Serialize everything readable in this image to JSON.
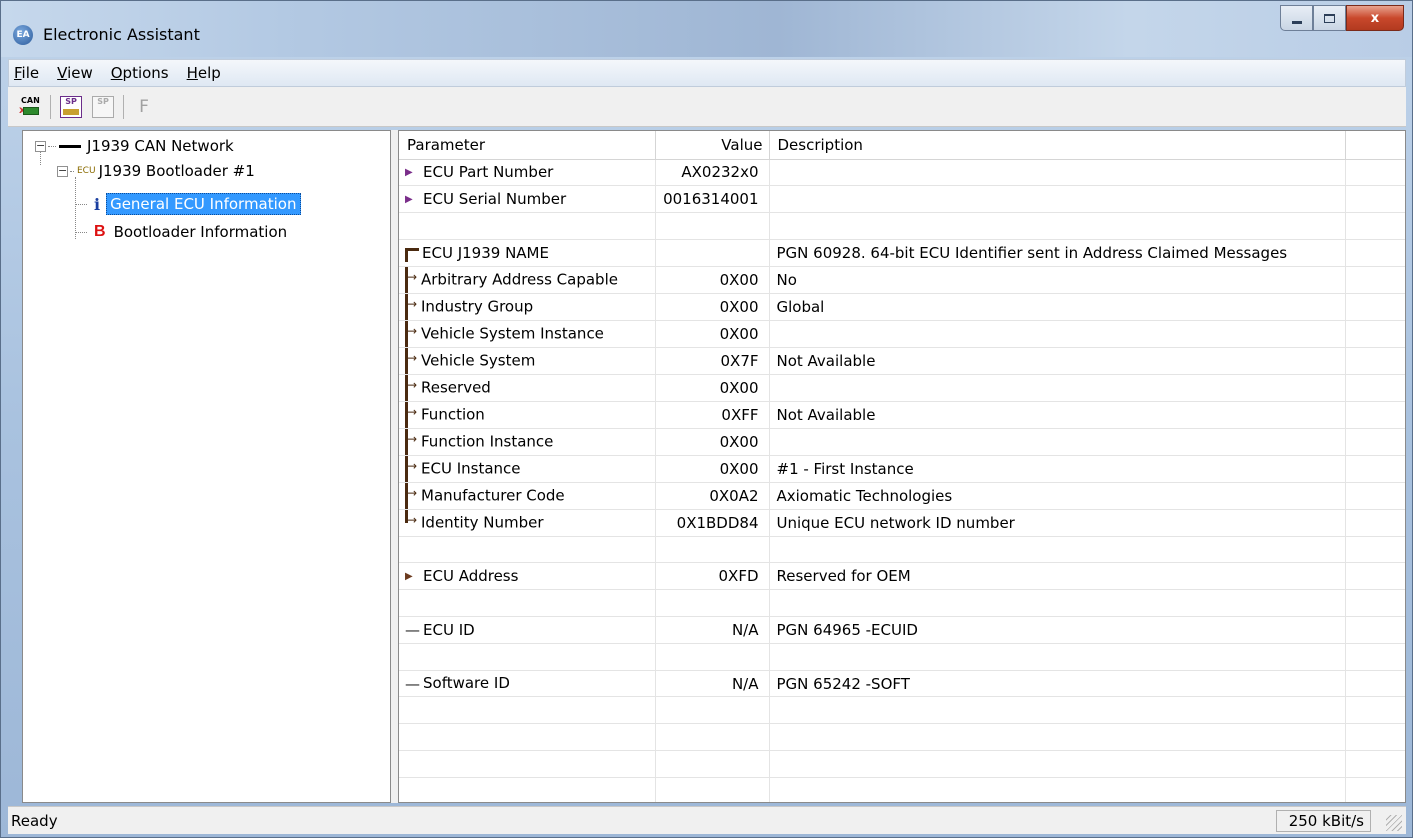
{
  "window": {
    "title": "Electronic Assistant",
    "app_icon": "EA",
    "close_glyph": "x"
  },
  "menu": [
    {
      "label": "File",
      "accel": "F",
      "rest": "ile"
    },
    {
      "label": "View",
      "accel": "V",
      "rest": "iew"
    },
    {
      "label": "Options",
      "accel": "O",
      "rest": "ptions"
    },
    {
      "label": "Help",
      "accel": "H",
      "rest": "elp"
    }
  ],
  "toolbar": {
    "can_label": "CAN",
    "sp_label": "SP",
    "f_label": "F"
  },
  "tree": {
    "network": "J1939 CAN Network",
    "ecu_tag": "ECU",
    "ecu": "J1939 Bootloader #1",
    "items": [
      {
        "icon": "i",
        "label": "General ECU Information",
        "selected": true
      },
      {
        "icon": "B",
        "label": "Bootloader Information",
        "selected": false
      }
    ]
  },
  "grid": {
    "headers": {
      "parameter": "Parameter",
      "value": "Value",
      "description": "Description"
    },
    "rows": [
      {
        "marker": "purple",
        "parameter": "ECU Part Number",
        "value": "AX0232x0",
        "description": ""
      },
      {
        "marker": "purple",
        "parameter": "ECU Serial Number",
        "value": "0016314001",
        "description": ""
      },
      {
        "marker": "none",
        "parameter": "",
        "value": "",
        "description": ""
      },
      {
        "marker": "top",
        "parameter": "ECU J1939 NAME",
        "value": "",
        "description": "PGN 60928. 64-bit ECU Identifier sent in Address Claimed Messages"
      },
      {
        "marker": "mid",
        "parameter": "Arbitrary Address Capable",
        "value": "0X00",
        "description": "No"
      },
      {
        "marker": "mid",
        "parameter": "Industry Group",
        "value": "0X00",
        "description": "Global"
      },
      {
        "marker": "mid",
        "parameter": "Vehicle System Instance",
        "value": "0X00",
        "description": ""
      },
      {
        "marker": "mid",
        "parameter": "Vehicle System",
        "value": "0X7F",
        "description": "Not Available"
      },
      {
        "marker": "mid",
        "parameter": "Reserved",
        "value": "0X00",
        "description": ""
      },
      {
        "marker": "mid",
        "parameter": "Function",
        "value": "0XFF",
        "description": "Not Available"
      },
      {
        "marker": "mid",
        "parameter": "Function Instance",
        "value": "0X00",
        "description": ""
      },
      {
        "marker": "mid",
        "parameter": "ECU Instance",
        "value": "0X00",
        "description": "#1 - First Instance"
      },
      {
        "marker": "mid",
        "parameter": "Manufacturer Code",
        "value": "0X0A2",
        "description": "Axiomatic Technologies"
      },
      {
        "marker": "end",
        "parameter": "Identity Number",
        "value": "0X1BDD84",
        "description": "Unique ECU network ID number"
      },
      {
        "marker": "none",
        "parameter": "",
        "value": "",
        "description": ""
      },
      {
        "marker": "brown",
        "parameter": "ECU Address",
        "value": "0XFD",
        "description": "Reserved for OEM"
      },
      {
        "marker": "none",
        "parameter": "",
        "value": "",
        "description": ""
      },
      {
        "marker": "dash",
        "parameter": "ECU ID",
        "value": "N/A",
        "description": "PGN 64965   -ECUID"
      },
      {
        "marker": "none",
        "parameter": "",
        "value": "",
        "description": ""
      },
      {
        "marker": "dash",
        "parameter": "Software ID",
        "value": "N/A",
        "description": "PGN 65242   -SOFT"
      },
      {
        "marker": "none",
        "parameter": "",
        "value": "",
        "description": ""
      },
      {
        "marker": "none",
        "parameter": "",
        "value": "",
        "description": ""
      },
      {
        "marker": "none",
        "parameter": "",
        "value": "",
        "description": ""
      },
      {
        "marker": "none",
        "parameter": "",
        "value": "",
        "description": ""
      }
    ]
  },
  "status": {
    "text": "Ready",
    "bitrate": "250 kBit/s"
  },
  "colors": {
    "selection": "#3399ff",
    "marker_purple": "#7a2d8a",
    "marker_brown": "#4a2a10"
  }
}
